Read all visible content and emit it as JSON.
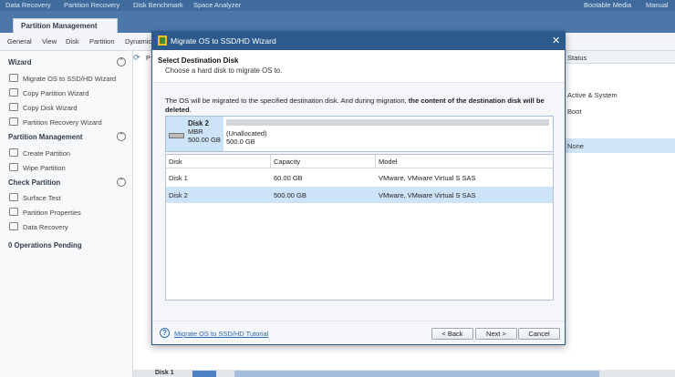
{
  "topnav": {
    "data_recovery": "Data Recovery",
    "partition_recovery": "Partition Recovery",
    "disk_benchmark": "Disk Benchmark",
    "space_analyzer": "Space Analyzer",
    "bootable_media": "Bootable Media",
    "manual": "Manual"
  },
  "tab": {
    "label": "Partition Management"
  },
  "menubar": {
    "general": "General",
    "view": "View",
    "disk": "Disk",
    "partition": "Partition",
    "dynamic": "Dynamic"
  },
  "sidebar": {
    "wizard": {
      "title": "Wizard",
      "items": [
        "Migrate OS to SSD/HD Wizard",
        "Copy Partition Wizard",
        "Copy Disk Wizard",
        "Partition Recovery Wizard"
      ]
    },
    "partition_management": {
      "title": "Partition Management",
      "items": [
        "Create Partition",
        "Wipe Partition"
      ]
    },
    "check_partition": {
      "title": "Check Partition",
      "items": [
        "Surface Test",
        "Partition Properties",
        "Data Recovery"
      ]
    },
    "ops_pending": "0 Operations Pending",
    "collapse_glyph": "⌃"
  },
  "main": {
    "partial_label": "P",
    "status_header": "Status",
    "status_rows": [
      "Active & System",
      "Boot"
    ],
    "selected_status": "None",
    "bottom_disk_label": "Disk 1"
  },
  "dialog": {
    "title": "Migrate OS to SSD/HD Wizard",
    "close": "✕",
    "heading": "Select Destination Disk",
    "subheading": "Choose a hard disk to migrate OS to.",
    "warning_plain": "The OS will be migrated to the specified destination disk. And during migration, ",
    "warning_bold": "the content of the destination disk will be deleted",
    "warning_end": ".",
    "diskmap": {
      "name": "Disk 2",
      "type": "MBR",
      "size": "500.00 GB",
      "partition_label": "(Unallocated)",
      "partition_size": "500.0 GB"
    },
    "table": {
      "headers": {
        "disk": "Disk",
        "capacity": "Capacity",
        "model": "Model"
      },
      "rows": [
        {
          "disk": "Disk 1",
          "capacity": "60.00 GB",
          "model": "VMware, VMware Virtual S SAS"
        },
        {
          "disk": "Disk 2",
          "capacity": "500.00 GB",
          "model": "VMware, VMware Virtual S SAS"
        }
      ]
    },
    "footer": {
      "help_glyph": "?",
      "tutorial_link": "Migrate OS to SSD/HD Tutorial",
      "back": "< Back",
      "next": "Next >",
      "cancel": "Cancel"
    }
  }
}
